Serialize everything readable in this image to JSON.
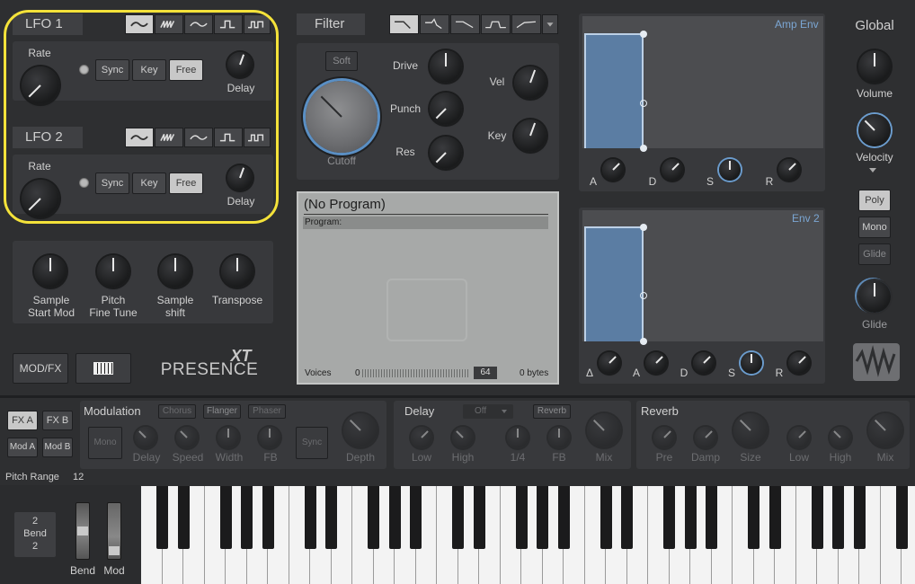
{
  "lfo1": {
    "title": "LFO 1",
    "rate": "Rate",
    "sync": "Sync",
    "key": "Key",
    "free": "Free",
    "delay": "Delay"
  },
  "lfo2": {
    "title": "LFO 2",
    "rate": "Rate",
    "sync": "Sync",
    "key": "Key",
    "free": "Free",
    "delay": "Delay"
  },
  "knobs_row": {
    "sample_start": "Sample\nStart Mod",
    "pitch_fine": "Pitch\nFine Tune",
    "sample_shift": "Sample\nshift",
    "transpose": "Transpose"
  },
  "modfx": "MOD/FX",
  "logo": {
    "xt": "XT",
    "presence": "PRESENCE"
  },
  "filter": {
    "title": "Filter",
    "soft": "Soft",
    "drive": "Drive",
    "punch": "Punch",
    "res": "Res",
    "cutoff": "Cutoff",
    "vel": "Vel",
    "key": "Key"
  },
  "program": {
    "name": "(No Program)",
    "label": "Program:",
    "voices": "Voices",
    "voices_min": "0",
    "voices_value": "64",
    "bytes": "0 bytes"
  },
  "amp_env": {
    "title": "Amp Env",
    "a": "A",
    "d": "D",
    "s": "S",
    "r": "R"
  },
  "env2": {
    "title": "Env 2",
    "delta": "Δ",
    "a": "A",
    "d": "D",
    "s": "S",
    "r": "R"
  },
  "global": {
    "title": "Global",
    "volume": "Volume",
    "velocity": "Velocity",
    "poly": "Poly",
    "mono": "Mono",
    "glide_btn": "Glide",
    "glide": "Glide"
  },
  "fxtabs": {
    "fxa": "FX A",
    "fxb": "FX B",
    "moda": "Mod A",
    "modb": "Mod B"
  },
  "modulation": {
    "title": "Modulation",
    "chorus": "Chorus",
    "flanger": "Flanger",
    "phaser": "Phaser",
    "mono": "Mono",
    "delay": "Delay",
    "speed": "Speed",
    "width": "Width",
    "fb": "FB",
    "sync": "Sync",
    "depth": "Depth"
  },
  "delay": {
    "title": "Delay",
    "off": "Off",
    "reverb": "Reverb",
    "low": "Low",
    "high": "High",
    "quarter": "1/4",
    "fb": "FB",
    "mix": "Mix"
  },
  "reverb": {
    "title": "Reverb",
    "pre": "Pre",
    "damp": "Damp",
    "size": "Size",
    "low": "Low",
    "high": "High",
    "mix": "Mix"
  },
  "pitch_range": {
    "label": "Pitch Range",
    "value": "12"
  },
  "bend": {
    "top": "2",
    "label": "Bend",
    "bottom": "2",
    "bend": "Bend",
    "mod": "Mod"
  },
  "colors": {
    "accent": "#6b9ccd",
    "highlight": "#f4e23a",
    "env_fill": "#5a7a9e"
  }
}
